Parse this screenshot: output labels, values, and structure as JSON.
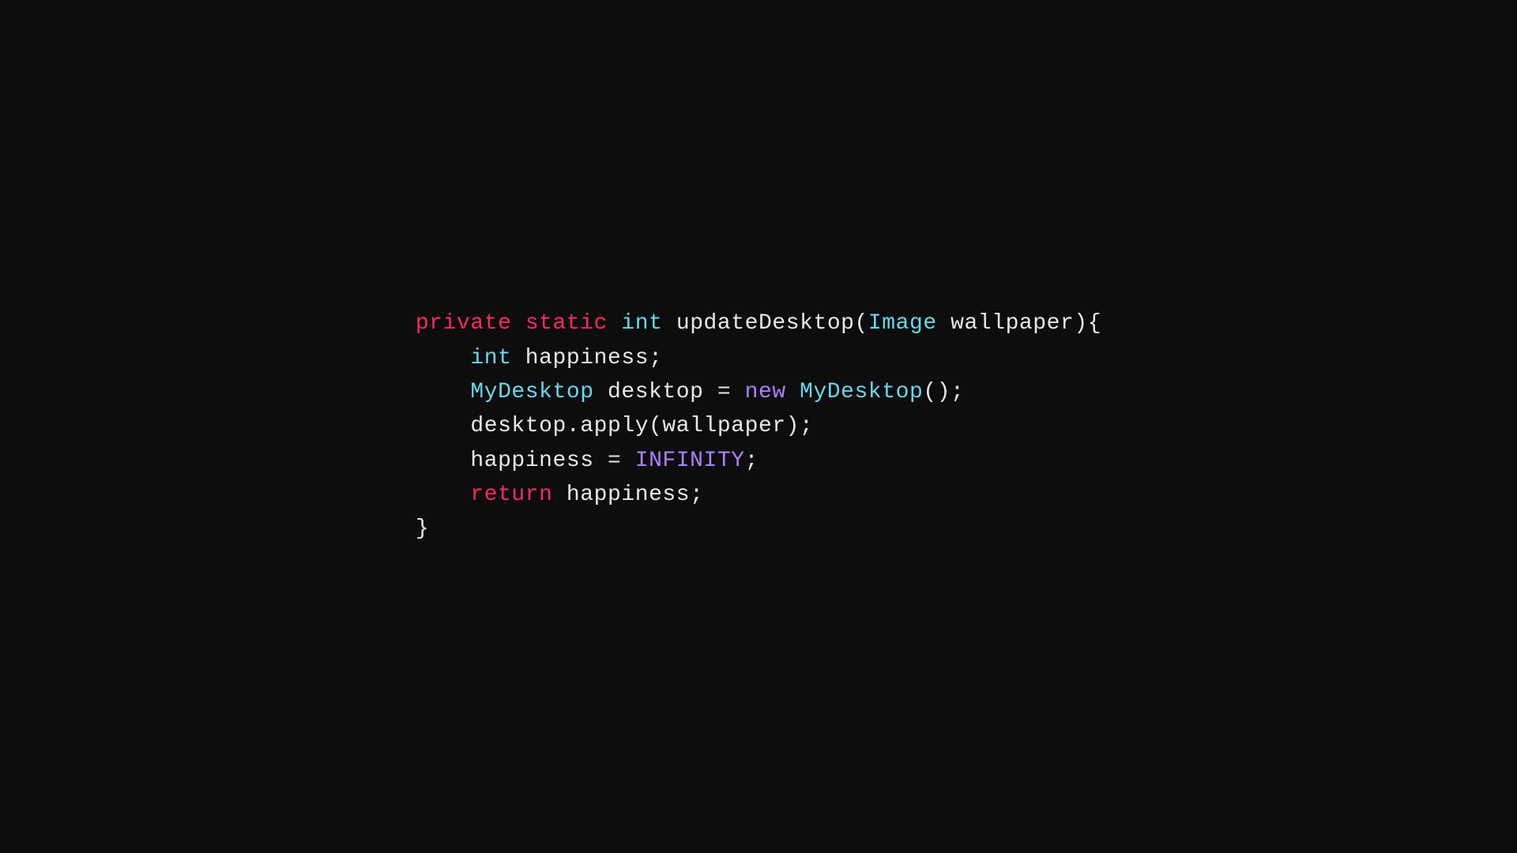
{
  "code": {
    "lines": [
      {
        "id": "line1",
        "tokens": [
          {
            "text": "private",
            "cls": "kw-private"
          },
          {
            "text": " ",
            "cls": "plain"
          },
          {
            "text": "static",
            "cls": "kw-static"
          },
          {
            "text": " ",
            "cls": "plain"
          },
          {
            "text": "int",
            "cls": "kw-int"
          },
          {
            "text": " updateDesktop(",
            "cls": "plain"
          },
          {
            "text": "Image",
            "cls": "class-name"
          },
          {
            "text": " wallpaper){",
            "cls": "plain"
          }
        ]
      },
      {
        "id": "line2",
        "tokens": [
          {
            "text": "    ",
            "cls": "plain"
          },
          {
            "text": "int",
            "cls": "kw-int"
          },
          {
            "text": " happiness;",
            "cls": "plain"
          }
        ]
      },
      {
        "id": "line3",
        "tokens": [
          {
            "text": "    ",
            "cls": "plain"
          },
          {
            "text": "MyDesktop",
            "cls": "class-name"
          },
          {
            "text": " desktop = ",
            "cls": "plain"
          },
          {
            "text": "new",
            "cls": "kw-new"
          },
          {
            "text": " ",
            "cls": "plain"
          },
          {
            "text": "MyDesktop",
            "cls": "class-name"
          },
          {
            "text": "();",
            "cls": "plain"
          }
        ]
      },
      {
        "id": "line4",
        "tokens": [
          {
            "text": "    desktop.apply(wallpaper);",
            "cls": "plain"
          }
        ]
      },
      {
        "id": "line5",
        "tokens": [
          {
            "text": "    happiness = ",
            "cls": "plain"
          },
          {
            "text": "INFINITY",
            "cls": "const-name"
          },
          {
            "text": ";",
            "cls": "plain"
          }
        ]
      },
      {
        "id": "line6",
        "tokens": [
          {
            "text": "    ",
            "cls": "plain"
          },
          {
            "text": "return",
            "cls": "kw-return"
          },
          {
            "text": " happiness;",
            "cls": "plain"
          }
        ]
      },
      {
        "id": "line7",
        "tokens": [
          {
            "text": "}",
            "cls": "plain"
          }
        ]
      }
    ]
  }
}
